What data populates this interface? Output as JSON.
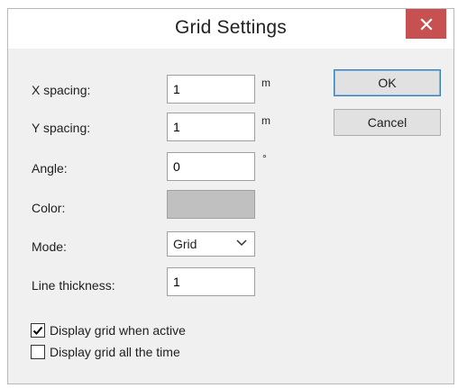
{
  "dialog": {
    "title": "Grid Settings",
    "close_icon": "close-icon"
  },
  "fields": {
    "x_spacing": {
      "label": "X spacing:",
      "value": "1",
      "unit": "m"
    },
    "y_spacing": {
      "label": "Y spacing:",
      "value": "1",
      "unit": "m"
    },
    "angle": {
      "label": "Angle:",
      "value": "0",
      "unit": "°"
    },
    "color": {
      "label": "Color:",
      "swatch": "#c0c0c0"
    },
    "mode": {
      "label": "Mode:",
      "selected": "Grid"
    },
    "line_thickness": {
      "label": "Line thickness:",
      "value": "1"
    }
  },
  "buttons": {
    "ok": "OK",
    "cancel": "Cancel"
  },
  "checkboxes": {
    "display_active": {
      "label": "Display grid when active",
      "checked": true
    },
    "display_always": {
      "label": "Display grid all the time",
      "checked": false
    }
  },
  "colors": {
    "close_bg": "#c75050",
    "dialog_bg": "#f0f0f0",
    "default_button_border": "#3c7fb1"
  }
}
